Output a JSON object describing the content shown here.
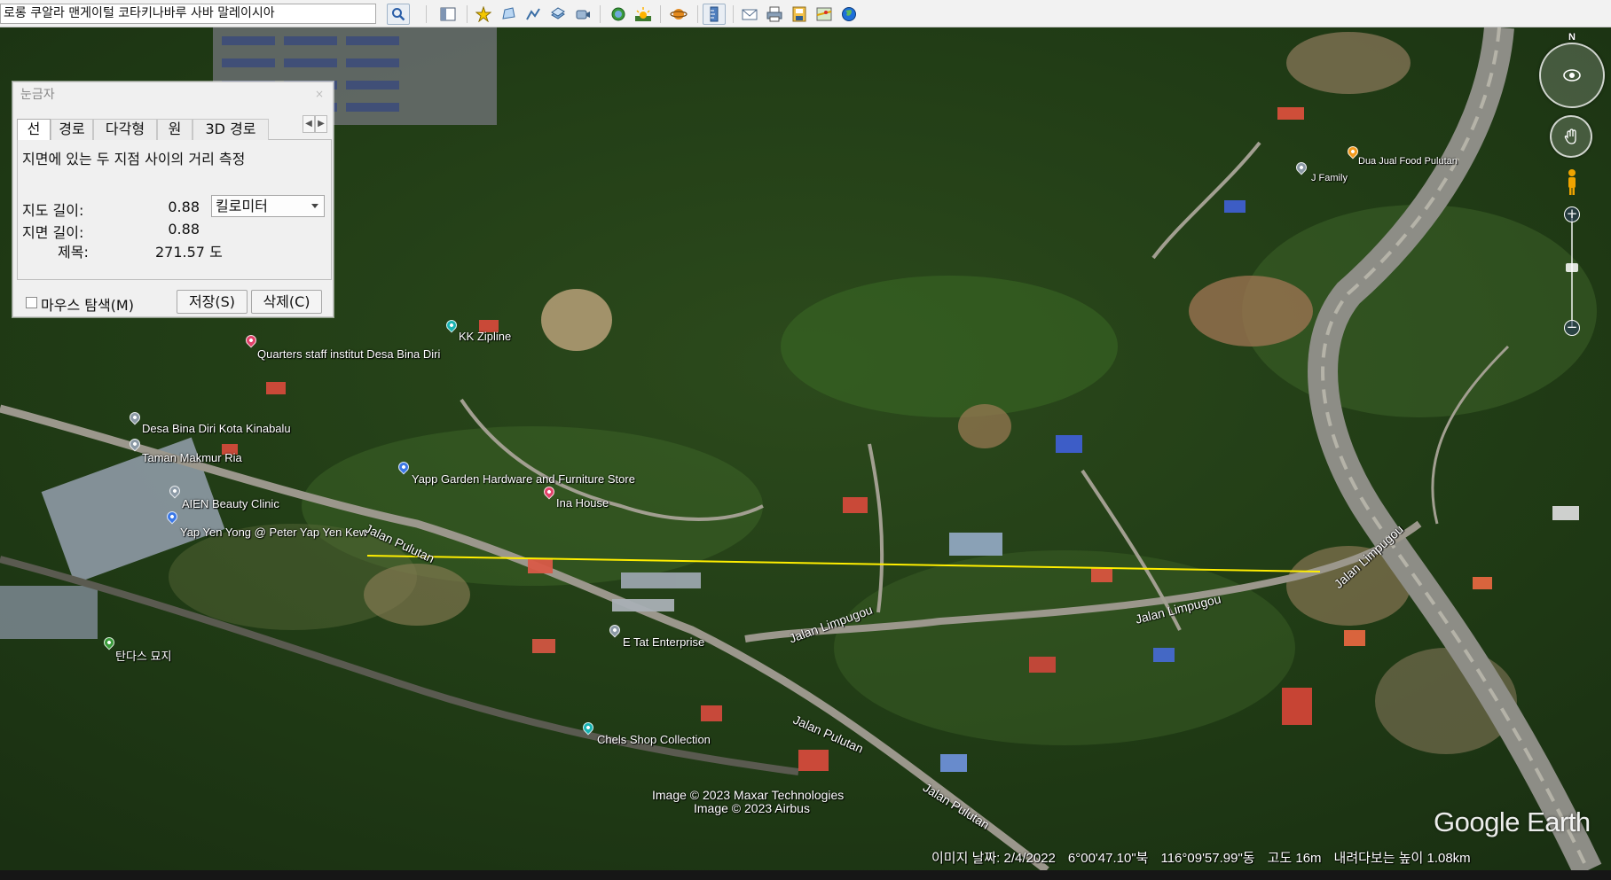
{
  "toolbar": {
    "search_text": "로롱 쿠알라 맨게이털 코타키나바루 사바 말레이시아",
    "icons": [
      "search-icon",
      "sidebar-icon",
      "placemark-icon",
      "polygon-icon",
      "path-icon",
      "overlay-icon",
      "record-tour-icon",
      "history-icon",
      "sun-icon",
      "planets-icon",
      "ruler-icon",
      "email-icon",
      "print-icon",
      "save-image-icon",
      "maps-icon",
      "earth-icon"
    ]
  },
  "ruler": {
    "title": "눈금자",
    "close": "×",
    "tabs": [
      "선",
      "경로",
      "다각형",
      "원",
      "3D 경로"
    ],
    "active_tab": "선",
    "description": "지면에 있는 두 지점 사이의 거리 측정",
    "map_length_label": "지도 길이:",
    "map_length_value": "0.88",
    "unit": "킬로미터",
    "ground_length_label": "지면 길이:",
    "ground_length_value": "0.88",
    "heading_label": "제목:",
    "heading_value": "271.57 도",
    "mouse_nav_label": "마우스 탐색(M)",
    "save_label": "저장(S)",
    "delete_label": "삭제(C)"
  },
  "map": {
    "places": [
      {
        "name": "Kuarters Staff Institut Desa Bina Diri",
        "label": "Quarters staff institut Desa Bina Diri"
      },
      {
        "name": "KK Zipline",
        "label": "KK Zipline"
      },
      {
        "name": "Desa Bina Diri Kota Kinabalu",
        "label": "Desa Bina Diri Kota Kinabalu"
      },
      {
        "name": "Taman Makmur Ria",
        "label": "Taman Makmur Ria"
      },
      {
        "name": "Yapp Garden Hardware",
        "label": "Yapp Garden Hardware and Furniture Store"
      },
      {
        "name": "Ina House",
        "label": "Ina House"
      },
      {
        "name": "AIEN Beauty Clinic",
        "label": "AIEN Beauty Clinic"
      },
      {
        "name": "Yap Yen Yong",
        "label": "Yap Yen Yong @ Peter Yap Yen Kew"
      },
      {
        "name": "Tandas Cemetery",
        "label": "탄다스 묘지"
      },
      {
        "name": "E Tat Enterprise",
        "label": "E Tat Enterprise"
      },
      {
        "name": "Chels Shop Collection",
        "label": "Chels Shop Collection"
      },
      {
        "name": "Dua Jual Food Pulutan",
        "label": "Dua Jual Food Pulutan"
      },
      {
        "name": "J Family",
        "label": "J Family"
      }
    ],
    "roads": {
      "pulutan_a": "Jalan Pulutan",
      "limpugou_a": "Jalan Limpugou",
      "limpugou_b": "Jalan Limpugou",
      "limpugou_c": "Jalan Limpugou",
      "pulutan_b": "Jalan Pulutan",
      "pulutan_c": "Jalan Pulutan"
    },
    "credits": [
      "Image © 2023 Maxar Technologies",
      "Image © 2023 Airbus"
    ],
    "measure_color": "#ffee00"
  },
  "status": {
    "image_date": "이미지 날짜: 2/4/2022",
    "lat": "6°00'47.10\"북",
    "lon": "116°09'57.99\"동",
    "elevation": "고도   16m",
    "eye_alt": "내려다보는 높이  1.08km"
  },
  "nav": {
    "north": "N",
    "logo": "Google Earth"
  }
}
